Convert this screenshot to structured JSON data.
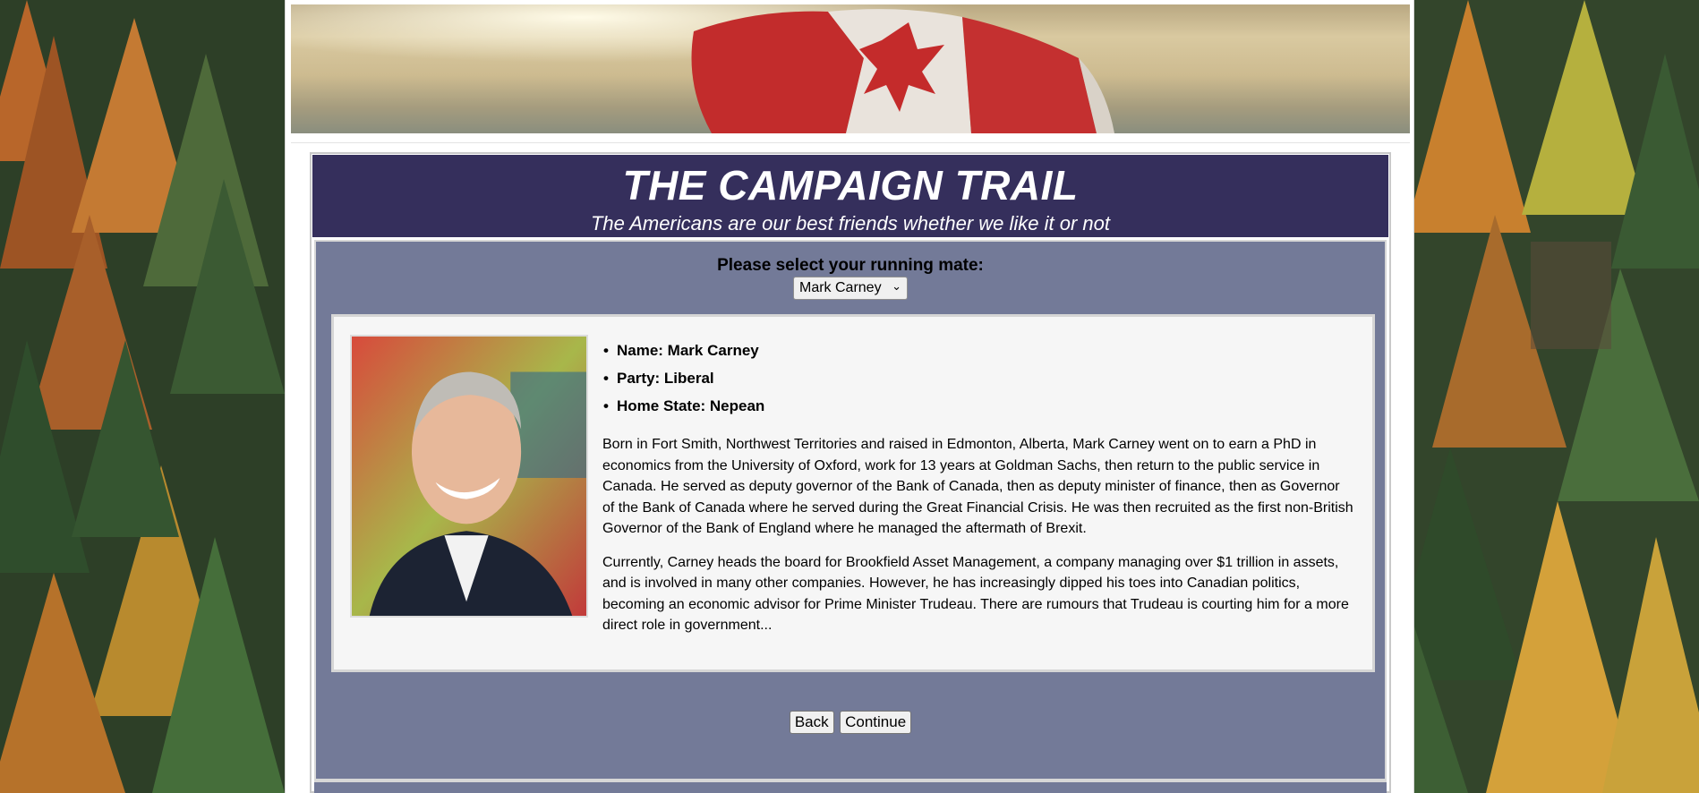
{
  "header": {
    "title": "THE CAMPAIGN TRAIL",
    "subtitle": "The Americans are our best friends whether we like it or not"
  },
  "selection": {
    "label": "Please select your running mate:",
    "selected": "Mark Carney",
    "chevron": "⌄"
  },
  "candidate": {
    "facts": [
      "Name: Mark Carney",
      "Party: Liberal",
      "Home State: Nepean"
    ],
    "bio": [
      "Born in Fort Smith, Northwest Territories and raised in Edmonton, Alberta, Mark Carney went on to earn a PhD in economics from the University of Oxford, work for 13 years at Goldman Sachs, then return to the public service in Canada. He served as deputy governor of the Bank of Canada, then as deputy minister of finance, then as Governor of the Bank of Canada where he served during the Great Financial Crisis. He was then recruited as the first non-British Governor of the Bank of England where he managed the aftermath of Brexit.",
      "Currently, Carney heads the board for Brookfield Asset Management, a company managing over $1 trillion in assets, and is involved in many other companies. However, he has increasingly dipped his toes into Canadian politics, becoming an economic advisor for Prime Minister Trudeau. There are rumours that Trudeau is courting him for a more direct role in government..."
    ]
  },
  "buttons": {
    "back": "Back",
    "continue": "Continue"
  },
  "colors": {
    "header_bg": "#352f5c",
    "panel_bg": "#737a98",
    "card_bg": "#f6f6f6"
  }
}
